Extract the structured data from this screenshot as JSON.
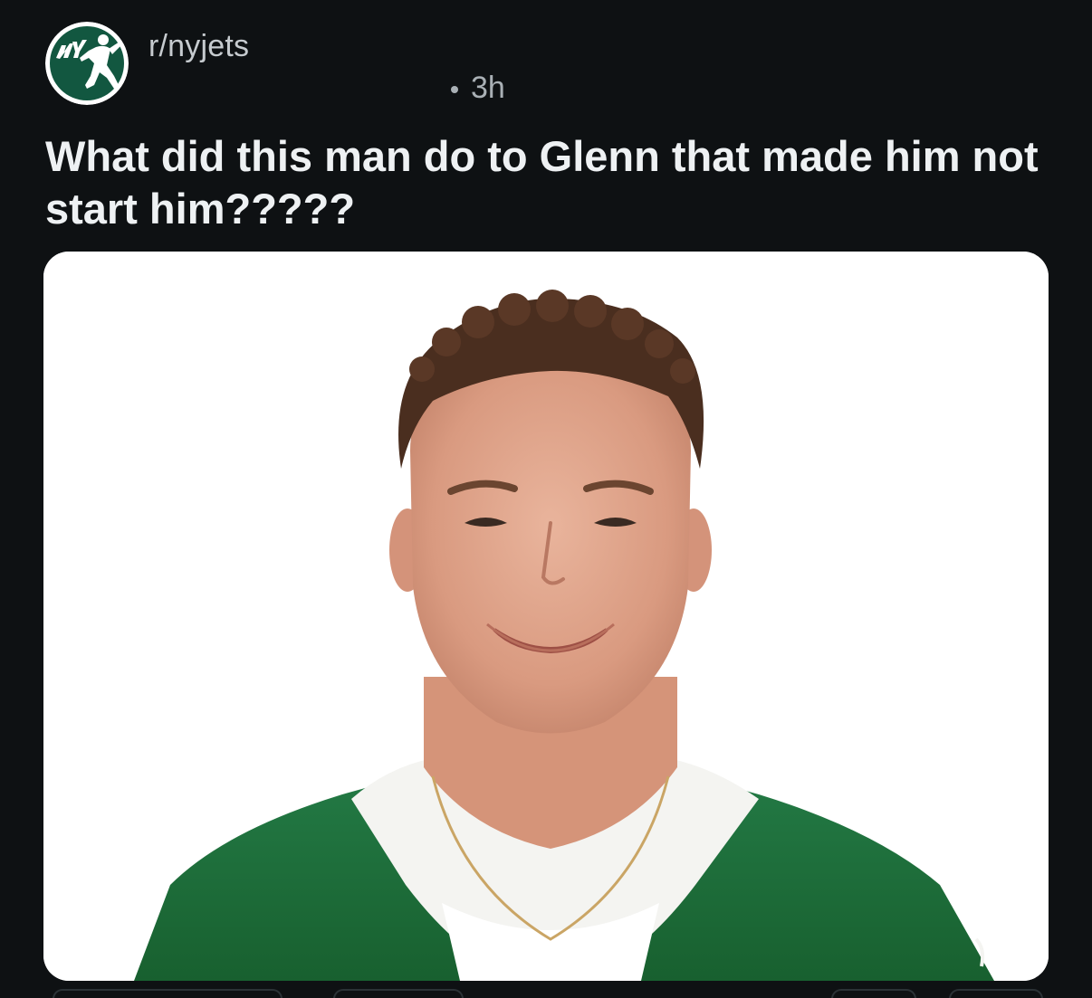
{
  "subreddit": {
    "name": "r/nyjets",
    "logo_icon": "nyjets-logo-icon",
    "logo_color": "#125740"
  },
  "post": {
    "age": "3h",
    "title": "What did this man do to Glenn that made him not start him?????"
  },
  "media": {
    "icon": "player-headshot-image",
    "background_color": "#ffffff",
    "jersey_color": "#1e6b3c"
  },
  "theme": {
    "background": "#0e1113",
    "title_color": "#eef1f3",
    "meta_color": "#a9b0b5"
  }
}
